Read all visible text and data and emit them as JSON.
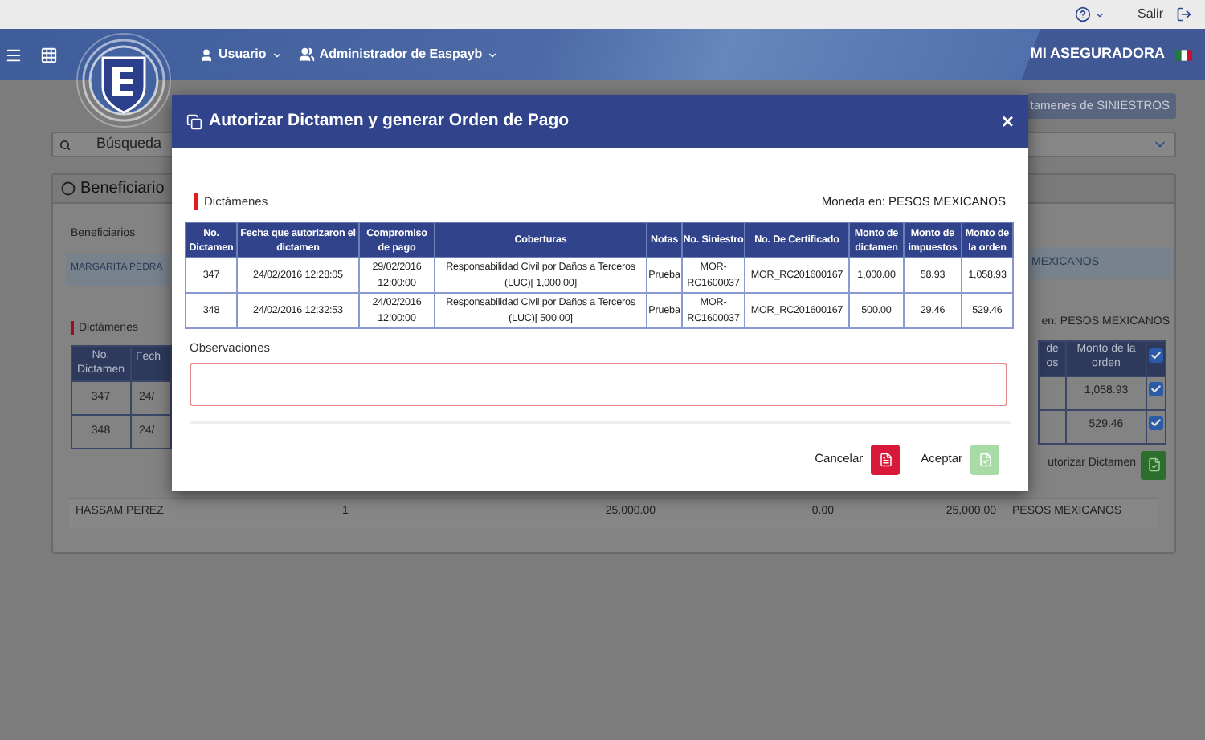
{
  "topbar": {
    "logout": "Salir"
  },
  "header": {
    "user_menu": "Usuario",
    "role_menu": "Administrador de Easpayb",
    "company": "MI ASEGURADORA"
  },
  "background": {
    "siniestros_button": "tamenes de SINIESTROS",
    "search_label": "Búsqueda",
    "panel_title": "Beneficiario",
    "beneficiaries_label": "Beneficiarios",
    "beneficiary_row": {
      "name": "MARGARITA PEDRA",
      "currency": "MEXICANOS"
    },
    "section_title": "Dictámenes",
    "currency_label": "en: PESOS MEXICANOS",
    "table_left": {
      "columns": [
        "No. Dictamen",
        "Fech"
      ],
      "rows": [
        [
          "347",
          "24/"
        ],
        [
          "348",
          "24/"
        ]
      ]
    },
    "table_right": {
      "columns": [
        "de os",
        "Monto de la orden"
      ],
      "all_checked": true,
      "rows": [
        {
          "amount": "1,058.93",
          "checked": true
        },
        {
          "amount": "529.46",
          "checked": true
        }
      ]
    },
    "authorize_button": "utorizar Dictamen",
    "summary_row": [
      "HASSAM PEREZ",
      "1",
      "25,000.00",
      "0.00",
      "25,000.00",
      "PESOS MEXICANOS"
    ]
  },
  "modal": {
    "title": "Autorizar Dictamen y generar Orden de Pago",
    "close": "×",
    "section_title": "Dictámenes",
    "currency": "Moneda en: PESOS MEXICANOS",
    "table": {
      "columns": [
        "No. Dictamen",
        "Fecha que autorizaron el dictamen",
        "Compromiso de pago",
        "Coberturas",
        "Notas",
        "No. Siniestro",
        "No. De Certificado",
        "Monto de dictamen",
        "Monto de impuestos",
        "Monto de la orden"
      ],
      "rows": [
        [
          "347",
          "24/02/2016 12:28:05",
          "29/02/2016 12:00:00",
          "Responsabilidad Civil por Daños a Terceros (LUC)[ 1,000.00]",
          "Prueba",
          "MOR-RC1600037",
          "MOR_RC201600167",
          "1,000.00",
          "58.93",
          "1,058.93"
        ],
        [
          "348",
          "24/02/2016 12:32:53",
          "24/02/2016 12:00:00",
          "Responsabilidad Civil por Daños a Terceros (LUC)[ 500.00]",
          "Prueba",
          "MOR-RC1600037",
          "MOR_RC201600167",
          "500.00",
          "29.46",
          "529.46"
        ]
      ]
    },
    "observations_label": "Observaciones",
    "buttons": [
      {
        "kind": "cancel",
        "label": "Cancelar",
        "disabled": false
      },
      {
        "kind": "accept",
        "label": "Aceptar",
        "disabled": true
      }
    ]
  }
}
